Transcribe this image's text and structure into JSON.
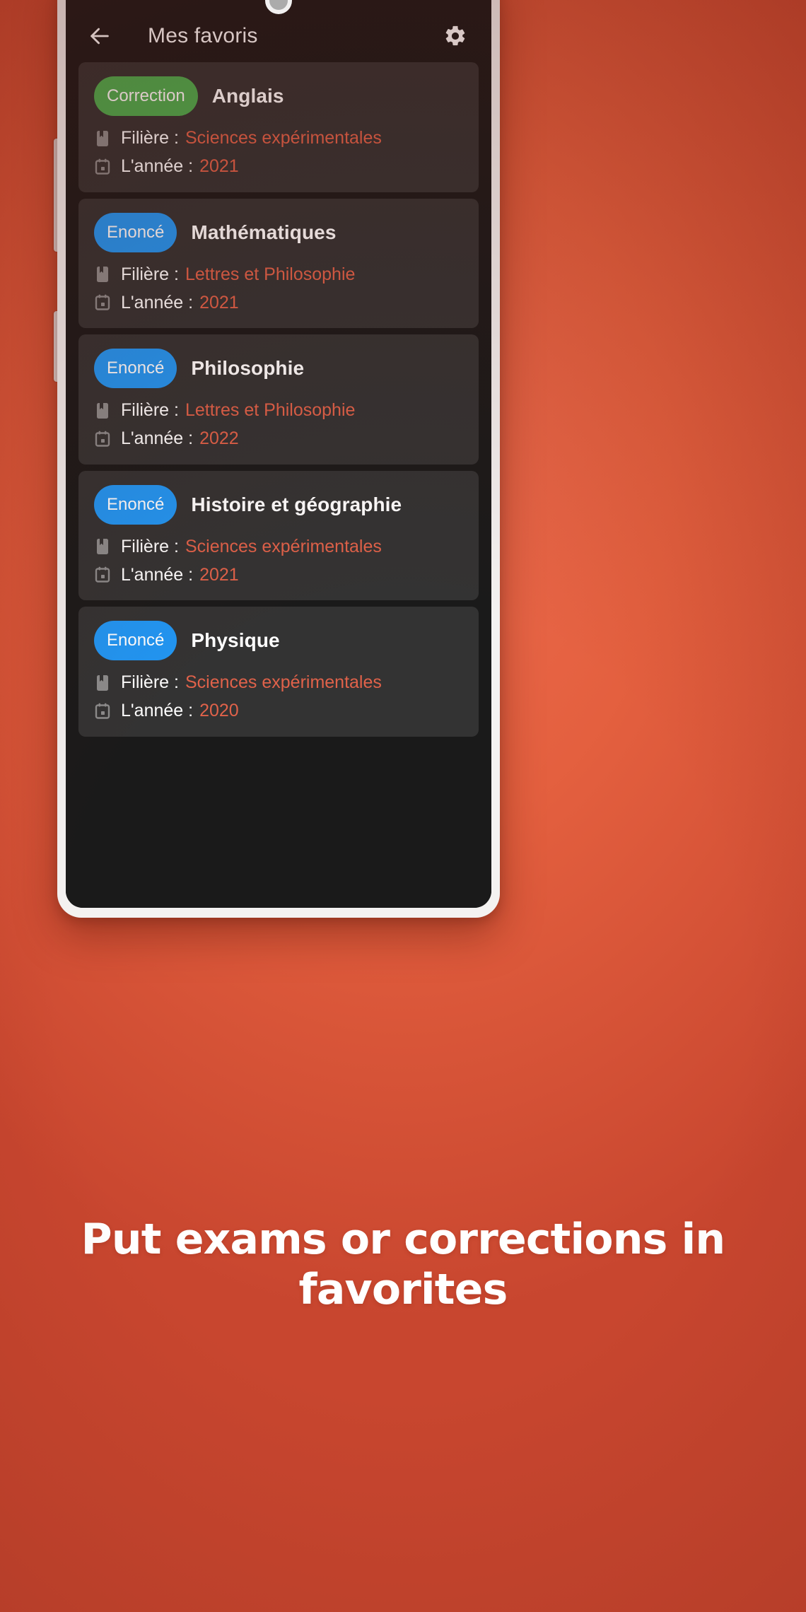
{
  "colors": {
    "background_start": "#EC6B4E",
    "background_end": "#C8462F",
    "screen_bg": "#1A1A1A",
    "card_bg": "#333333",
    "badge_correction": "#4CAF50",
    "badge_enonce": "#2196F3",
    "meta_value": "#E0624A",
    "text_primary": "#FFFFFF"
  },
  "appbar": {
    "back_icon": "arrow-left-icon",
    "title": "Mes favoris",
    "settings_icon": "gear-icon"
  },
  "labels": {
    "filiere": "Filière :",
    "annee": "L'année :",
    "filiere_icon": "bookmark-icon",
    "annee_icon": "calendar-icon"
  },
  "cards": [
    {
      "badge": "Correction",
      "badge_type": "green",
      "title": "Anglais",
      "filiere": "Sciences expérimentales",
      "annee": "2021"
    },
    {
      "badge": "Enoncé",
      "badge_type": "blue",
      "title": "Mathématiques",
      "filiere": "Lettres et Philosophie",
      "annee": "2021"
    },
    {
      "badge": "Enoncé",
      "badge_type": "blue",
      "title": "Philosophie",
      "filiere": "Lettres et Philosophie",
      "annee": "2022"
    },
    {
      "badge": "Enoncé",
      "badge_type": "blue",
      "title": "Histoire et géographie",
      "filiere": "Sciences expérimentales",
      "annee": "2021"
    },
    {
      "badge": "Enoncé",
      "badge_type": "blue",
      "title": "Physique",
      "filiere": "Sciences expérimentales",
      "annee": "2020"
    }
  ],
  "caption": {
    "line1": "Put exams or corrections in",
    "line2": "favorites"
  }
}
